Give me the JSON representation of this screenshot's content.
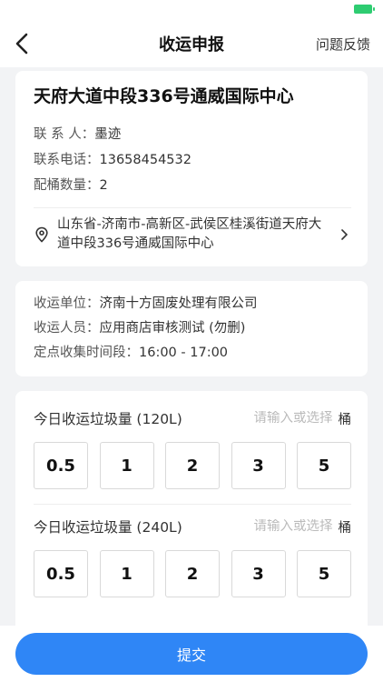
{
  "nav": {
    "title": "收运申报",
    "right": "问题反馈"
  },
  "site": {
    "name": "天府大道中段336号通威国际中心",
    "contact_label": "联 系 人：",
    "contact": "墨迹",
    "phone_label": "联系电话：",
    "phone": "13658454532",
    "bins_label": "配桶数量：",
    "bins": "2",
    "address": "山东省-济南市-高新区-武侯区桂溪街道天府大道中段336号通威国际中心"
  },
  "collector": {
    "unit_label": "收运单位：",
    "unit": "济南十方固废处理有限公司",
    "staff_label": "收运人员：",
    "staff": "应用商店审核测试 (勿删)",
    "time_label": "定点收集时间段：",
    "time": "16:00 - 17:00"
  },
  "amounts": [
    {
      "label": "今日收运垃圾量 (120L)",
      "placeholder": "请输入或选择",
      "unit": "桶",
      "options": [
        "0.5",
        "1",
        "2",
        "3",
        "5"
      ]
    },
    {
      "label": "今日收运垃圾量 (240L)",
      "placeholder": "请输入或选择",
      "unit": "桶",
      "options": [
        "0.5",
        "1",
        "2",
        "3",
        "5"
      ]
    }
  ],
  "submit_label": "提交",
  "colors": {
    "accent": "#2f86f6",
    "battery": "#2ecc71"
  }
}
